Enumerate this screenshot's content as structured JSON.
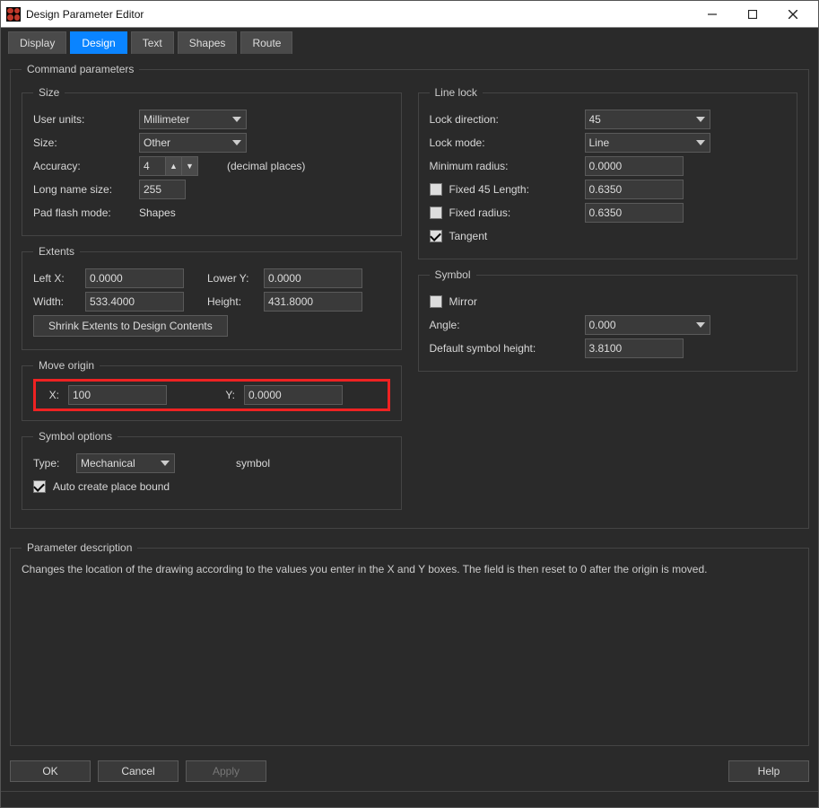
{
  "window": {
    "title": "Design Parameter Editor"
  },
  "tabs": [
    "Display",
    "Design",
    "Text",
    "Shapes",
    "Route"
  ],
  "active_tab": "Design",
  "group": {
    "command_parameters": "Command parameters"
  },
  "size": {
    "legend": "Size",
    "user_units_label": "User units:",
    "user_units_value": "Millimeter",
    "size_label": "Size:",
    "size_value": "Other",
    "accuracy_label": "Accuracy:",
    "accuracy_value": "4",
    "accuracy_suffix": "(decimal places)",
    "long_name_label": "Long name size:",
    "long_name_value": "255",
    "pad_flash_label": "Pad flash mode:",
    "pad_flash_value": "Shapes"
  },
  "extents": {
    "legend": "Extents",
    "leftx_label": "Left X:",
    "leftx_value": "0.0000",
    "lowery_label": "Lower Y:",
    "lowery_value": "0.0000",
    "width_label": "Width:",
    "width_value": "533.4000",
    "height_label": "Height:",
    "height_value": "431.8000",
    "shrink_btn": "Shrink Extents to Design Contents"
  },
  "move_origin": {
    "legend": "Move origin",
    "x_label": "X:",
    "x_value": "100",
    "y_label": "Y:",
    "y_value": "0.0000"
  },
  "symbol_options": {
    "legend": "Symbol options",
    "type_label": "Type:",
    "type_value": "Mechanical",
    "type_suffix": "symbol",
    "auto_create_label": "Auto create place bound",
    "auto_create_checked": true
  },
  "line_lock": {
    "legend": "Line lock",
    "lock_direction_label": "Lock direction:",
    "lock_direction_value": "45",
    "lock_mode_label": "Lock mode:",
    "lock_mode_value": "Line",
    "min_radius_label": "Minimum radius:",
    "min_radius_value": "0.0000",
    "fixed45_label": "Fixed 45 Length:",
    "fixed45_value": "0.6350",
    "fixed45_checked": false,
    "fixed_radius_label": "Fixed radius:",
    "fixed_radius_value": "0.6350",
    "fixed_radius_checked": false,
    "tangent_label": "Tangent",
    "tangent_checked": true
  },
  "symbol": {
    "legend": "Symbol",
    "mirror_label": "Mirror",
    "mirror_checked": false,
    "angle_label": "Angle:",
    "angle_value": "0.000",
    "default_h_label": "Default symbol height:",
    "default_h_value": "3.8100"
  },
  "param_desc": {
    "legend": "Parameter description",
    "text": "Changes the location of the drawing according to the values you enter in the X and Y boxes. The field is then reset to 0 after the origin is moved."
  },
  "buttons": {
    "ok": "OK",
    "cancel": "Cancel",
    "apply": "Apply",
    "help": "Help"
  }
}
